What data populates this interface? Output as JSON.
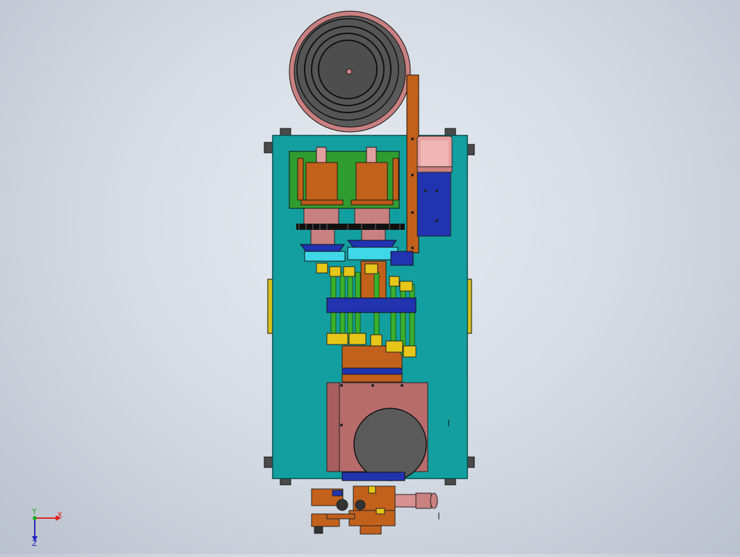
{
  "viewport": {
    "background_top": "#e8ecf2",
    "background_bottom": "#b9c1cd"
  },
  "model": {
    "plate_color": "#139f9f",
    "green_plate_color": "#2f9c2f",
    "copper_color": "#c2611c",
    "pink_color": "#c98080",
    "blue_color": "#2233b0",
    "dark_color": "#4f4f4f",
    "green_rod_color": "#3ab02c",
    "yellow_color": "#e6c619"
  },
  "triad": {
    "x_label": "X",
    "y_label": "Y",
    "z_label": "Z",
    "x_color": "#d22",
    "y_color": "#2a2",
    "z_color": "#22b"
  }
}
